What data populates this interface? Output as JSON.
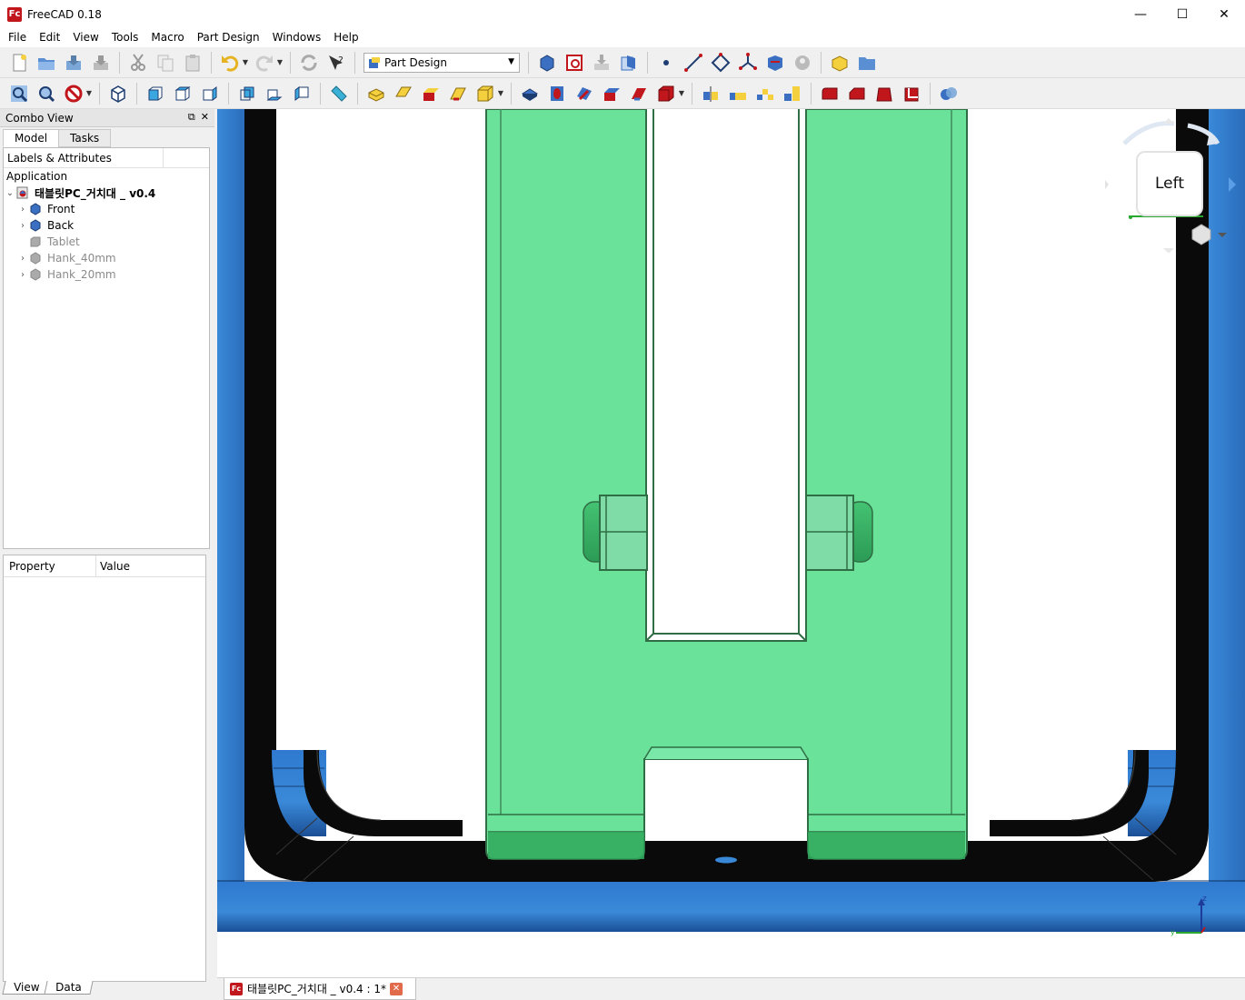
{
  "window": {
    "title": "FreeCAD 0.18",
    "logo_text": "Fc",
    "minimize": "—",
    "maximize": "☐",
    "close": "✕"
  },
  "menu": [
    "File",
    "Edit",
    "View",
    "Tools",
    "Macro",
    "Part Design",
    "Windows",
    "Help"
  ],
  "workbench": {
    "selected": "Part Design"
  },
  "combo_view": {
    "title": "Combo View",
    "float_icon": "⧉",
    "close_icon": "✕",
    "tabs": [
      "Model",
      "Tasks"
    ]
  },
  "tree": {
    "header": "Labels & Attributes",
    "application": "Application",
    "document": {
      "label": "태블릿PC_거치대 _ v0.4",
      "arrow": "⌄"
    },
    "items": [
      {
        "label": "Front",
        "arrow": "›",
        "visible": true
      },
      {
        "label": "Back",
        "arrow": "›",
        "visible": true
      },
      {
        "label": "Tablet",
        "arrow": "",
        "visible": false
      },
      {
        "label": "Hank_40mm",
        "arrow": "›",
        "visible": false
      },
      {
        "label": "Hank_20mm",
        "arrow": "›",
        "visible": false
      }
    ]
  },
  "property": {
    "col_property": "Property",
    "col_value": "Value"
  },
  "bottom_tabs": [
    "View",
    "Data"
  ],
  "navcube": {
    "face": "Left"
  },
  "axis": {
    "z": "z",
    "y": "y"
  },
  "doc_tab": {
    "label": "태블릿PC_거치대 _ v0.4 : 1*",
    "close": "✕"
  },
  "colors": {
    "part_blue": "#3a89d8",
    "part_black": "#0a0a0a",
    "transparent_green": "#6be29a",
    "green_edge": "#2f6e45"
  }
}
